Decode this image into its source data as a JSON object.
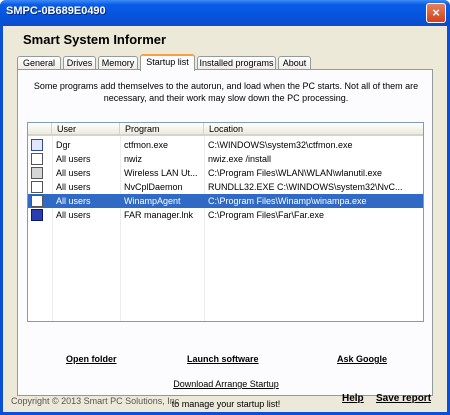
{
  "window": {
    "title": "SMPC-0B689E0490",
    "close_glyph": "×"
  },
  "app": {
    "title": "Smart System Informer"
  },
  "tabs": [
    {
      "label": "General"
    },
    {
      "label": "Drives"
    },
    {
      "label": "Memory"
    },
    {
      "label": "Startup list"
    },
    {
      "label": "Installed programs"
    },
    {
      "label": "About"
    }
  ],
  "active_tab": "Startup list",
  "intro": "Some programs add themselves to the autorun, and load when the PC starts. Not all of them are necessary, and their work may slow down the PC processing.",
  "startup_list": {
    "columns": [
      "User",
      "Program",
      "Location"
    ],
    "rows": [
      {
        "icon": "notepad-pencil-icon",
        "user": "Dgr",
        "program": "ctfmon.exe",
        "location": "C:\\WINDOWS\\system32\\ctfmon.exe",
        "selected": false
      },
      {
        "icon": "blank-app-icon",
        "user": "All users",
        "program": "nwiz",
        "location": "nwiz.exe /install",
        "selected": false
      },
      {
        "icon": "wireless-checker-icon",
        "user": "All users",
        "program": "Wireless LAN Ut...",
        "location": "C:\\Program Files\\WLAN\\WLAN\\wlanutil.exe",
        "selected": false
      },
      {
        "icon": "blank-app-icon",
        "user": "All users",
        "program": "NvCplDaemon",
        "location": "RUNDLL32.EXE C:\\WINDOWS\\system32\\NvC...",
        "selected": false
      },
      {
        "icon": "blank-app-icon",
        "user": "All users",
        "program": "WinampAgent",
        "location": "C:\\Program Files\\Winamp\\winampa.exe",
        "selected": true
      },
      {
        "icon": "far-manager-icon",
        "user": "All users",
        "program": "FAR manager.lnk",
        "location": "C:\\Program Files\\Far\\Far.exe",
        "selected": false
      }
    ]
  },
  "actions": {
    "open_folder": "Open folder",
    "launch_software": "Launch software",
    "ask_google": "Ask Google"
  },
  "download_link": "Download Arrange Startup",
  "download_note": "to manage your startup list!",
  "footer": {
    "copyright": "Copyright © 2013 Smart PC Solutions, Inc",
    "help": "Help",
    "save_report": "Save report"
  },
  "colors": {
    "titlebar": "#0a5ce8",
    "selection": "#316ac5",
    "tab_accent": "#ff9e3e",
    "client_bg": "#ece9d8"
  }
}
